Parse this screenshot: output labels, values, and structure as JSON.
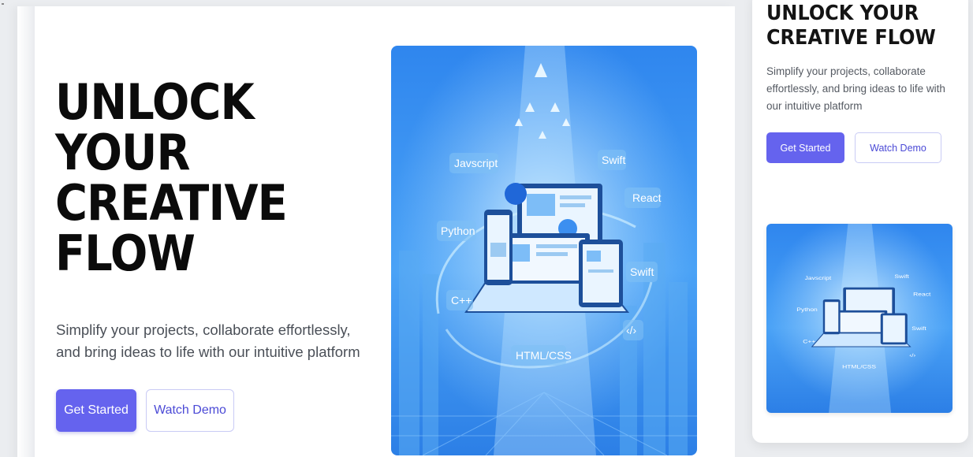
{
  "hero": {
    "title_lines": [
      "UNLOCK",
      "YOUR",
      "CREATIVE",
      "FLOW"
    ],
    "subtitle": "Simplify your projects, collaborate effortlessly, and bring ideas to life with our intuitive platform",
    "primary_button": "Get Started",
    "secondary_button": "Watch Demo"
  },
  "illustration": {
    "labels": {
      "javascript": "Javscript",
      "swift_top": "Swift",
      "react": "React",
      "python": "Python",
      "swift_mid": "Swift",
      "cpp": "C++",
      "code_tag": "‹/›",
      "html_css": "HTML/CSS"
    }
  },
  "mobile": {
    "title_lines": [
      "UNLOCK YOUR",
      "CREATIVE FLOW"
    ],
    "subtitle": "Simplify your projects, collaborate effortlessly, and bring ideas to life with our intuitive platform",
    "primary_button": "Get Started",
    "secondary_button": "Watch Demo"
  },
  "colors": {
    "accent": "#6563ee",
    "secondary_text": "#4b4ad6",
    "illustration_blue": "#3c8ff0"
  }
}
